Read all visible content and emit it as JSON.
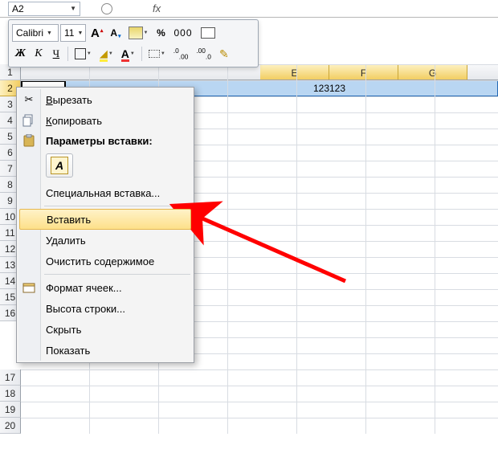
{
  "name_box": {
    "ref": "A2"
  },
  "formula_bar": {
    "fx_label": "fx"
  },
  "mini_toolbar": {
    "font_name": "Calibri",
    "font_size": "11",
    "percent": "%",
    "thousands": "000",
    "dec_inc": ",0▲",
    "dec_dec": ",00▼"
  },
  "columns": [
    "E",
    "F",
    "G"
  ],
  "selected_row": 2,
  "cell_value": {
    "text": "123123"
  },
  "rows_visible": [
    1,
    2,
    3,
    4,
    5,
    6,
    7,
    8,
    9,
    10,
    11,
    12,
    13,
    14,
    15,
    16,
    17,
    18,
    19,
    20
  ],
  "rows_obscured_from": 3,
  "rows_obscured_to": 15,
  "context_menu": {
    "cut": "Вырезать",
    "copy": "Копировать",
    "paste_options": "Параметры вставки:",
    "paste_special": "Специальная вставка...",
    "insert": "Вставить",
    "delete": "Удалить",
    "clear": "Очистить содержимое",
    "format_cells": "Формат ячеек...",
    "row_height": "Высота строки...",
    "hide": "Скрыть",
    "show": "Показать",
    "paste_btn_char": "A"
  }
}
